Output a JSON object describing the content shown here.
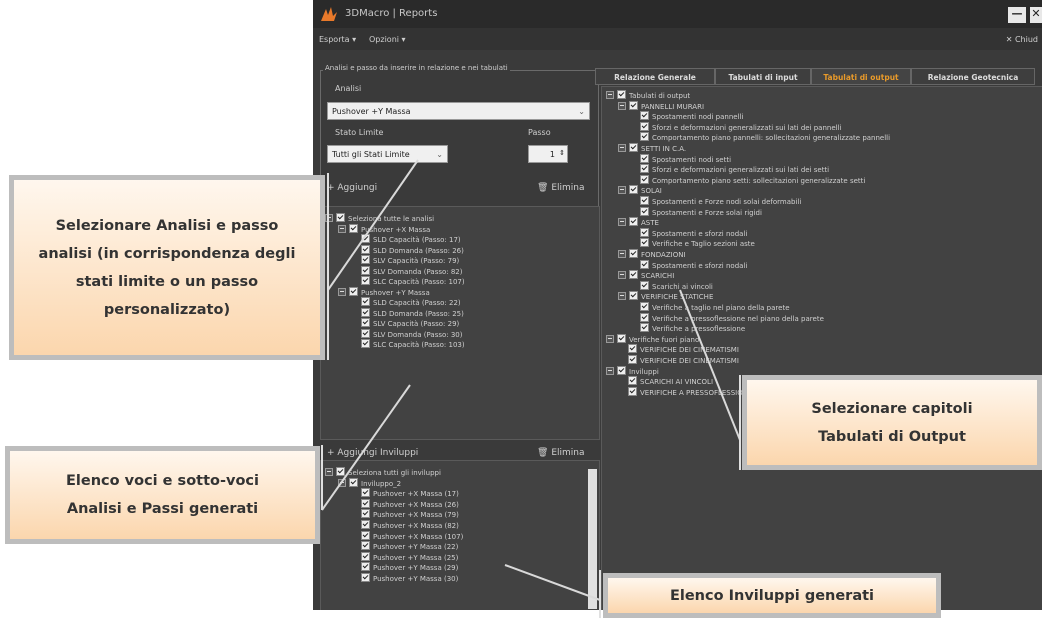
{
  "window": {
    "title": "3DMacro | Reports",
    "minimize": "—",
    "close": "✕"
  },
  "menu": {
    "esporta": "Esporta ▾",
    "opzioni": "Opzioni ▾",
    "chiudi": "✕ Chiud"
  },
  "left": {
    "group_title": "Analisi e passo da inserire in relazione e nei tabulati",
    "analisi_label": "Analisi",
    "analisi_value": "Pushover +Y Massa",
    "stato_label": "Stato Limite",
    "stato_value": "Tutti gli Stati Limite",
    "passo_label": "Passo",
    "passo_value": "1",
    "aggiungi": "+ Aggiungi",
    "elimina": "Elimina",
    "analysis_tree": [
      {
        "lvl": 0,
        "exp": true,
        "text": "Seleziona tutte le analisi"
      },
      {
        "lvl": 1,
        "exp": true,
        "text": "Pushover +X Massa"
      },
      {
        "lvl": 2,
        "exp": false,
        "text": "SLD Capacità (Passo: 17)"
      },
      {
        "lvl": 2,
        "exp": false,
        "text": "SLD Domanda (Passo: 26)"
      },
      {
        "lvl": 2,
        "exp": false,
        "text": "SLV Capacità (Passo: 79)"
      },
      {
        "lvl": 2,
        "exp": false,
        "text": "SLV Domanda (Passo: 82)"
      },
      {
        "lvl": 2,
        "exp": false,
        "text": "SLC Capacità (Passo: 107)"
      },
      {
        "lvl": 1,
        "exp": true,
        "text": "Pushover +Y Massa"
      },
      {
        "lvl": 2,
        "exp": false,
        "text": "SLD Capacità (Passo: 22)"
      },
      {
        "lvl": 2,
        "exp": false,
        "text": "SLD Domanda (Passo: 25)"
      },
      {
        "lvl": 2,
        "exp": false,
        "text": "SLV Capacità (Passo: 29)"
      },
      {
        "lvl": 2,
        "exp": false,
        "text": "SLV Domanda (Passo: 30)"
      },
      {
        "lvl": 2,
        "exp": false,
        "text": "SLC Capacità (Passo: 103)"
      }
    ],
    "aggiungi_inviluppi": "+ Aggiungi Inviluppi",
    "elimina2": "Elimina",
    "envelope_tree": [
      {
        "lvl": 0,
        "exp": true,
        "text": "Seleziona tutti gli inviluppi"
      },
      {
        "lvl": 1,
        "exp": true,
        "text": "Inviluppo_2"
      },
      {
        "lvl": 2,
        "exp": false,
        "text": "Pushover +X Massa (17)"
      },
      {
        "lvl": 2,
        "exp": false,
        "text": "Pushover +X Massa (26)"
      },
      {
        "lvl": 2,
        "exp": false,
        "text": "Pushover +X Massa (79)"
      },
      {
        "lvl": 2,
        "exp": false,
        "text": "Pushover +X Massa (82)"
      },
      {
        "lvl": 2,
        "exp": false,
        "text": "Pushover +X Massa (107)"
      },
      {
        "lvl": 2,
        "exp": false,
        "text": "Pushover +Y Massa (22)"
      },
      {
        "lvl": 2,
        "exp": false,
        "text": "Pushover +Y Massa (25)"
      },
      {
        "lvl": 2,
        "exp": false,
        "text": "Pushover +Y Massa (29)"
      },
      {
        "lvl": 2,
        "exp": false,
        "text": "Pushover +Y Massa (30)"
      }
    ]
  },
  "tabs": [
    "Relazione Generale",
    "Tabulati di input",
    "Tabulati di output",
    "Relazione Geotecnica"
  ],
  "active_tab_color": "#e89a2a",
  "output_tree": [
    {
      "lvl": 0,
      "exp": true,
      "text": "Tabulati di output"
    },
    {
      "lvl": 1,
      "exp": true,
      "text": "PANNELLI MURARI"
    },
    {
      "lvl": 2,
      "exp": false,
      "text": "Spostamenti nodi pannelli"
    },
    {
      "lvl": 2,
      "exp": false,
      "text": "Sforzi e deformazioni generalizzati sui lati dei pannelli"
    },
    {
      "lvl": 2,
      "exp": false,
      "text": "Comportamento piano pannelli: sollecitazioni generalizzate pannelli"
    },
    {
      "lvl": 1,
      "exp": true,
      "text": "SETTI IN C.A."
    },
    {
      "lvl": 2,
      "exp": false,
      "text": "Spostamenti nodi setti"
    },
    {
      "lvl": 2,
      "exp": false,
      "text": "Sforzi e deformazioni generalizzati sui lati dei setti"
    },
    {
      "lvl": 2,
      "exp": false,
      "text": "Comportamento piano setti: sollecitazioni generalizzate setti"
    },
    {
      "lvl": 1,
      "exp": true,
      "text": "SOLAI"
    },
    {
      "lvl": 2,
      "exp": false,
      "text": "Spostamenti e Forze nodi solai deformabili"
    },
    {
      "lvl": 2,
      "exp": false,
      "text": "Spostamenti e Forze solai rigidi"
    },
    {
      "lvl": 1,
      "exp": true,
      "text": "ASTE"
    },
    {
      "lvl": 2,
      "exp": false,
      "text": "Spostamenti e sforzi nodali"
    },
    {
      "lvl": 2,
      "exp": false,
      "text": "Verifiche e Taglio sezioni aste"
    },
    {
      "lvl": 1,
      "exp": true,
      "text": "FONDAZIONI"
    },
    {
      "lvl": 2,
      "exp": false,
      "text": "Spostamenti e sforzi nodali"
    },
    {
      "lvl": 1,
      "exp": true,
      "text": "SCARICHI"
    },
    {
      "lvl": 2,
      "exp": false,
      "text": "Scarichi ai vincoli"
    },
    {
      "lvl": 1,
      "exp": true,
      "text": "VERIFICHE STATICHE"
    },
    {
      "lvl": 2,
      "exp": false,
      "text": "Verifiche a taglio nel piano della parete"
    },
    {
      "lvl": 2,
      "exp": false,
      "text": "Verifiche a pressoflessione nel piano della parete"
    },
    {
      "lvl": 2,
      "exp": false,
      "text": "Verifiche a pressoflessione"
    },
    {
      "lvl": 0,
      "exp": true,
      "text": "Verifiche fuori piano"
    },
    {
      "lvl": 1,
      "exp": false,
      "text": "VERIFICHE DEI CINEMATISMI"
    },
    {
      "lvl": 1,
      "exp": false,
      "text": "VERIFICHE DEI CINEMATISMI"
    },
    {
      "lvl": 0,
      "exp": true,
      "text": "Inviluppi"
    },
    {
      "lvl": 1,
      "exp": false,
      "text": "SCARICHI AI VINCOLI"
    },
    {
      "lvl": 1,
      "exp": false,
      "text": "VERIFICHE A PRESSOFLESSIONE"
    }
  ],
  "callouts": {
    "c1": "Selezionare Analisi e passo analisi (in corrispondenza degli stati limite o un passo personalizzato)",
    "c2": "Elenco voci e sotto-voci Analisi e Passi generati",
    "c3": "Selezionare capitoli Tabulati di Output",
    "c4": "Elenco Inviluppi generati"
  }
}
